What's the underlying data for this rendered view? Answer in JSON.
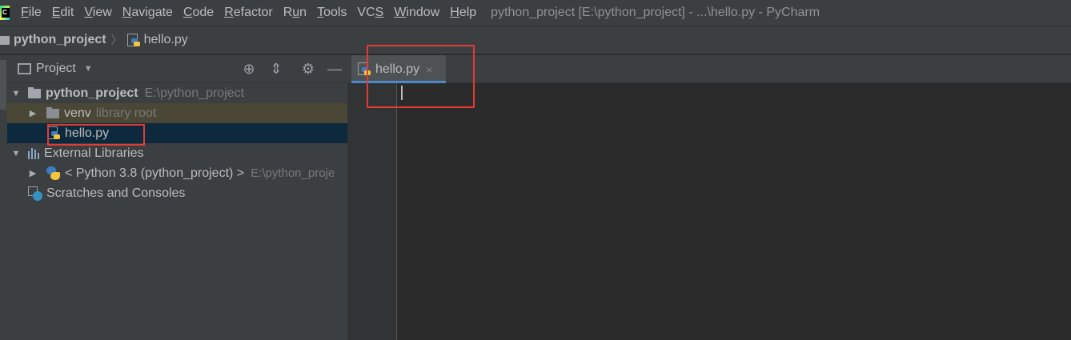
{
  "menubar": {
    "items": [
      {
        "pre": "",
        "u": "F",
        "post": "ile"
      },
      {
        "pre": "",
        "u": "E",
        "post": "dit"
      },
      {
        "pre": "",
        "u": "V",
        "post": "iew"
      },
      {
        "pre": "",
        "u": "N",
        "post": "avigate"
      },
      {
        "pre": "",
        "u": "C",
        "post": "ode"
      },
      {
        "pre": "",
        "u": "R",
        "post": "efactor"
      },
      {
        "pre": "R",
        "u": "u",
        "post": "n"
      },
      {
        "pre": "",
        "u": "T",
        "post": "ools"
      },
      {
        "pre": "VC",
        "u": "S",
        "post": ""
      },
      {
        "pre": "",
        "u": "W",
        "post": "indow"
      },
      {
        "pre": "",
        "u": "H",
        "post": "elp"
      }
    ],
    "window_title": "python_project [E:\\python_project] - ...\\hello.py - PyCharm"
  },
  "navbar": {
    "project": "python_project",
    "file": "hello.py"
  },
  "project_panel": {
    "title": "Project",
    "tree": {
      "root_label": "python_project",
      "root_path": "E:\\python_project",
      "venv_label": "venv",
      "venv_hint": "library root",
      "file_label": "hello.py",
      "ext_libs_label": "External Libraries",
      "python_label": "< Python 3.8 (python_project) >",
      "python_path": "E:\\python_proje",
      "scratches_label": "Scratches and Consoles"
    }
  },
  "editor": {
    "tab_label": "hello.py",
    "tab_close": "×"
  },
  "colors": {
    "highlight": "#e53935",
    "tab_underline": "#4a88c7",
    "selection": "#0d293e"
  }
}
